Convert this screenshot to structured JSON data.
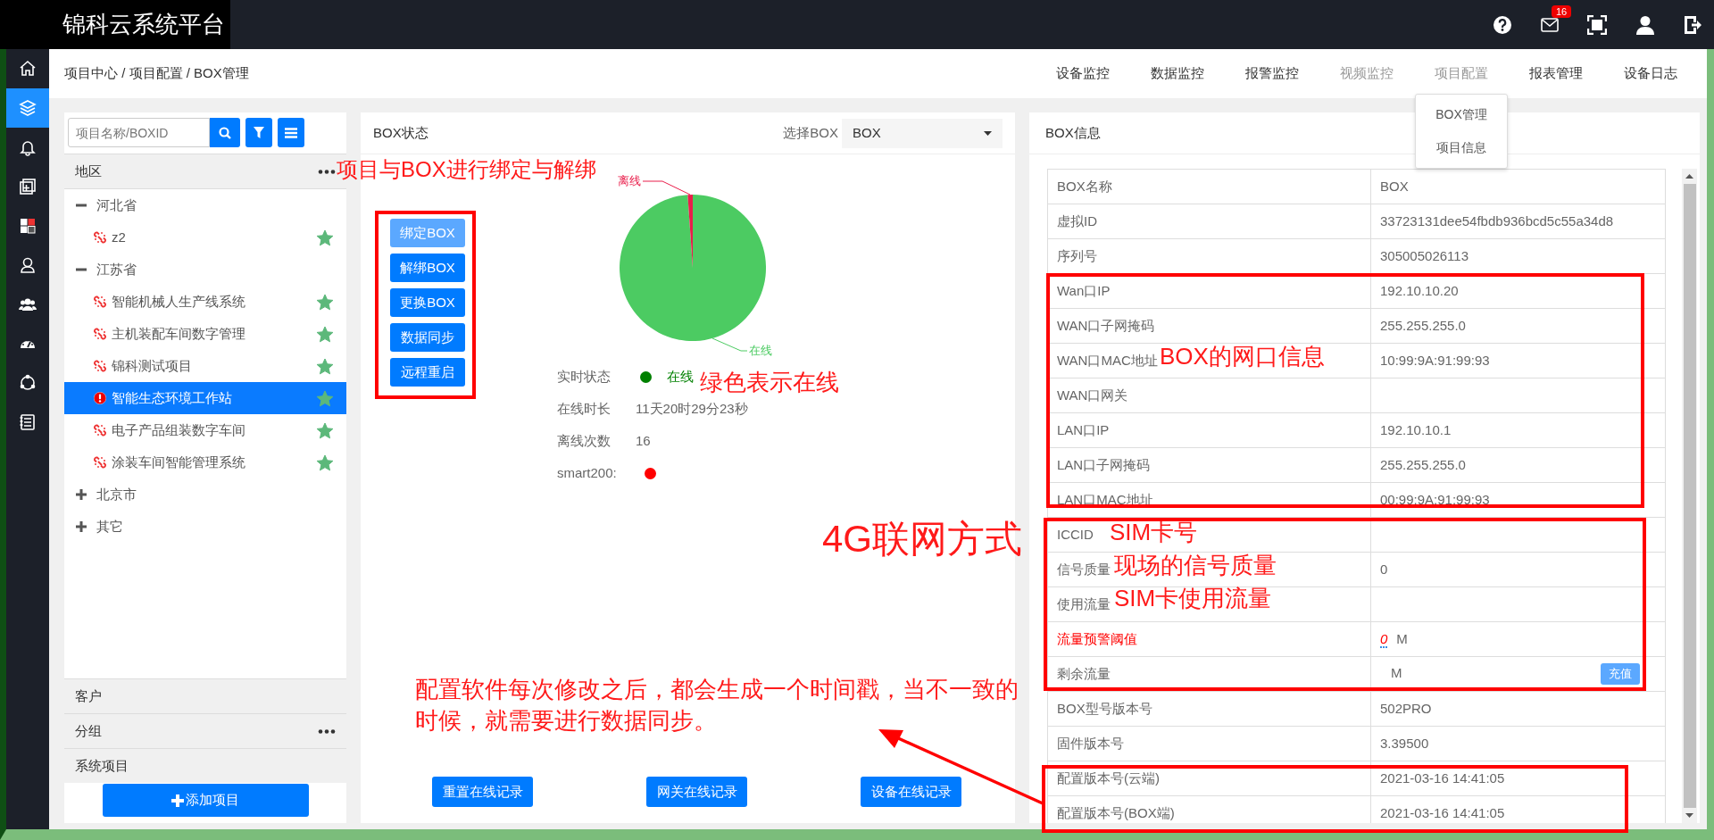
{
  "app": {
    "title": "锦科云系统平台",
    "mail_badge": "16"
  },
  "sidebar": [
    {
      "selected": false
    },
    {
      "selected": true
    },
    {
      "selected": false
    },
    {
      "selected": false
    },
    {
      "selected": false
    },
    {
      "selected": false
    },
    {
      "selected": false
    },
    {
      "selected": false
    },
    {
      "selected": false
    },
    {
      "selected": false
    }
  ],
  "breadcrumb": "项目中心 / 项目配置 / BOX管理",
  "nav": [
    {
      "label": "设备监控",
      "dimmed": false
    },
    {
      "label": "数据监控",
      "dimmed": false
    },
    {
      "label": "报警监控",
      "dimmed": false
    },
    {
      "label": "视频监控",
      "dimmed": true
    },
    {
      "label": "项目配置",
      "dimmed": true,
      "menu": [
        "BOX管理",
        "项目信息"
      ]
    },
    {
      "label": "报表管理",
      "dimmed": false
    },
    {
      "label": "设备日志",
      "dimmed": false
    }
  ],
  "project_panel": {
    "search": {
      "placeholder": "项目名称/BOXID"
    },
    "region_header": "地区",
    "tree": [
      {
        "label": "河北省",
        "expanded": true,
        "children": [
          {
            "label": "z2",
            "alarm": false,
            "starred": true,
            "selected": false
          }
        ]
      },
      {
        "label": "江苏省",
        "expanded": true,
        "children": [
          {
            "label": "智能机械人生产线系统",
            "alarm": false,
            "starred": true,
            "selected": false
          },
          {
            "label": "主机装配车间数字管理",
            "alarm": false,
            "starred": true,
            "selected": false
          },
          {
            "label": "锦科测试项目",
            "alarm": false,
            "starred": true,
            "selected": false
          },
          {
            "label": "智能生态环境工作站",
            "alarm": true,
            "starred": true,
            "selected": true
          },
          {
            "label": "电子产品组装数字车间",
            "alarm": false,
            "starred": true,
            "selected": false
          },
          {
            "label": "涂装车间智能管理系统",
            "alarm": false,
            "starred": true,
            "selected": false
          }
        ]
      },
      {
        "label": "北京市",
        "expanded": false
      },
      {
        "label": "其它",
        "expanded": false
      }
    ],
    "sections": [
      {
        "label": "客户",
        "menu": false
      },
      {
        "label": "分组",
        "menu": true
      },
      {
        "label": "系统项目",
        "menu": false
      }
    ],
    "add_button": "添加项目"
  },
  "box_status": {
    "title": "BOX状态",
    "select_label": "选择BOX",
    "select_value": "BOX",
    "actions": [
      {
        "label": "绑定BOX",
        "disabled": true
      },
      {
        "label": "解绑BOX",
        "disabled": false
      },
      {
        "label": "更换BOX",
        "disabled": false
      },
      {
        "label": "数据同步",
        "disabled": false
      },
      {
        "label": "远程重启",
        "disabled": false
      }
    ],
    "pie": [
      {
        "label": "离线",
        "color": "#e91e4b"
      },
      {
        "label": "在线",
        "color": "#4ccb62"
      }
    ],
    "status_rows": [
      {
        "kind": "state",
        "label": "实时状态",
        "color": "#008000",
        "value": "在线"
      },
      {
        "kind": "text",
        "label": "在线时长",
        "value": "11天20时29分23秒"
      },
      {
        "kind": "text",
        "label": "离线次数",
        "value": "16"
      },
      {
        "kind": "dot",
        "label": "smart200:",
        "color": "#ff0000"
      }
    ],
    "record_buttons": [
      "重置在线记录",
      "网关在线记录",
      "设备在线记录"
    ]
  },
  "box_info": {
    "title": "BOX信息",
    "rows": [
      {
        "kind": "text",
        "label": "BOX名称",
        "value": "BOX"
      },
      {
        "kind": "text",
        "label": "虚拟ID",
        "value": "33723131dee54fbdb936bcd5c55a34d8"
      },
      {
        "kind": "text",
        "label": "序列号",
        "value": "305005026113"
      },
      {
        "kind": "text",
        "label": "Wan口IP",
        "value": "192.10.10.20"
      },
      {
        "kind": "text",
        "label": "WAN口子网掩码",
        "value": "255.255.255.0"
      },
      {
        "kind": "text",
        "label": "WAN口MAC地址",
        "value": "10:99:9A:91:99:93"
      },
      {
        "kind": "text",
        "label": "WAN口网关"
      },
      {
        "kind": "text",
        "label": "LAN口IP",
        "value": "192.10.10.1"
      },
      {
        "kind": "text",
        "label": "LAN口子网掩码",
        "value": "255.255.255.0"
      },
      {
        "kind": "text",
        "label": "LAN口MAC地址",
        "value": "00:99:9A:91:99:93"
      },
      {
        "kind": "text",
        "label": "ICCID"
      },
      {
        "kind": "text",
        "label": "信号质量",
        "value": "0"
      },
      {
        "kind": "text",
        "label": "使用流量"
      },
      {
        "kind": "threshold",
        "label": "流量预警阈值",
        "value": "0",
        "unit": "M"
      },
      {
        "kind": "recharge",
        "label": "剩余流量",
        "unit": "M",
        "button": "充值"
      },
      {
        "kind": "text",
        "label": "BOX型号版本号",
        "value": "502PRO"
      },
      {
        "kind": "text",
        "label": "固件版本号",
        "value": "3.39500"
      },
      {
        "kind": "text",
        "label": "配置版本号(云端)",
        "value": "2021-03-16 14:41:05"
      },
      {
        "kind": "text",
        "label": "配置版本号(BOX端)",
        "value": "2021-03-16 14:41:05"
      }
    ]
  },
  "annotations": [
    {
      "kind": "note",
      "text": "项目与BOX进行绑定与解绑"
    },
    {
      "kind": "frame"
    },
    {
      "kind": "note",
      "text": "绿色表示在线"
    },
    {
      "kind": "note",
      "text": "BOX的网口信息"
    },
    {
      "kind": "frame"
    },
    {
      "kind": "note",
      "text": "4G联网方式"
    },
    {
      "kind": "frame"
    },
    {
      "kind": "note",
      "text": "SIM卡号"
    },
    {
      "kind": "note",
      "text": "现场的信号质量"
    },
    {
      "kind": "note",
      "text": "SIM卡使用流量"
    },
    {
      "kind": "note",
      "text": "配置软件每次修改之后，都会生成一个时间戳，当不一致的时候，就需要进行数据同步。"
    },
    {
      "kind": "arrow"
    },
    {
      "kind": "frame"
    }
  ]
}
